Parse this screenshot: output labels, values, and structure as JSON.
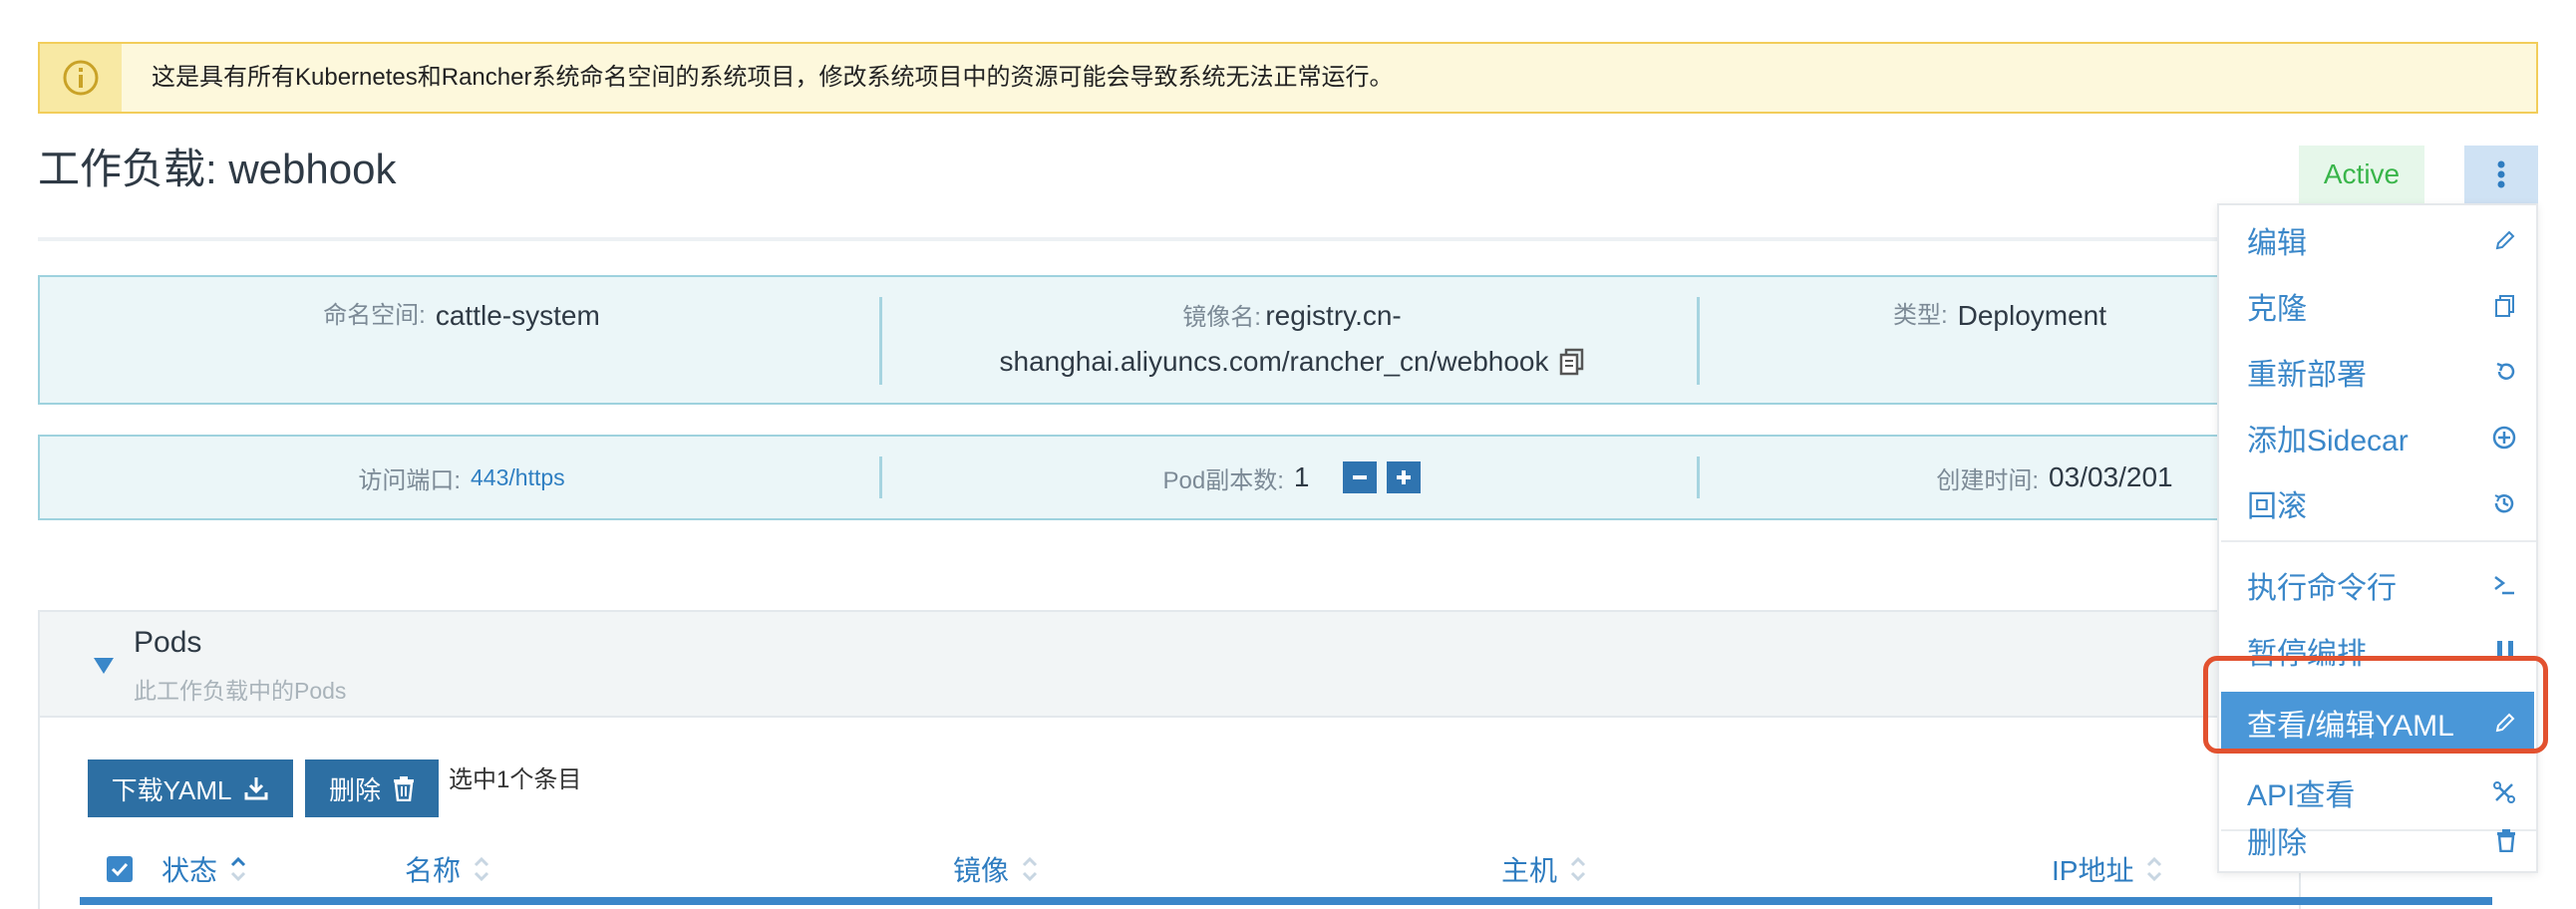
{
  "banner": {
    "text": "这是具有所有Kubernetes和Rancher系统命名空间的系统项目，修改系统项目中的资源可能会导致系统无法正常运行。",
    "icon": "info-circle-icon"
  },
  "header": {
    "title": "工作负载: webhook",
    "status": "Active",
    "more_icon": "vertical-dots-icon"
  },
  "info": {
    "namespace_label": "命名空间:",
    "namespace_value": "cattle-system",
    "image_label": "镜像名:",
    "image_value_line1": "registry.cn-",
    "image_value_line2": "shanghai.aliyuncs.com/rancher_cn/webhook",
    "type_label": "类型:",
    "type_value": "Deployment",
    "port_label": "访问端口:",
    "port_value": "443/https",
    "replicas_label": "Pod副本数:",
    "replicas_value": "1",
    "created_label": "创建时间:",
    "created_value": "03/03/201"
  },
  "pods": {
    "title": "Pods",
    "subtitle": "此工作负载中的Pods",
    "download_label": "下载YAML",
    "delete_label": "删除",
    "selected_text": "选中1个条目",
    "columns": [
      "状态",
      "名称",
      "镜像",
      "主机",
      "IP地址"
    ]
  },
  "menu": {
    "items": [
      {
        "label": "编辑",
        "icon": "pencil-icon"
      },
      {
        "label": "克隆",
        "icon": "copy-icon"
      },
      {
        "label": "重新部署",
        "icon": "redo-icon"
      },
      {
        "label": "添加Sidecar",
        "icon": "plus-circle-icon"
      },
      {
        "label": "回滚",
        "icon": "history-icon"
      },
      {
        "label": "执行命令行",
        "icon": "terminal-icon"
      },
      {
        "label": "暂停编排",
        "icon": "pause-icon"
      },
      {
        "label": "查看/编辑YAML",
        "icon": "pencil-icon",
        "active": true
      },
      {
        "label": "API查看",
        "icon": "api-tools-icon"
      },
      {
        "label": "删除",
        "icon": "trash-icon"
      }
    ]
  },
  "colors": {
    "accent": "#3a87c9",
    "active_item": "#4a97d8",
    "button": "#2d6fa3",
    "status_green": "#39b54a",
    "highlight": "#e2512f",
    "banner_bg": "#fdf8dc"
  }
}
